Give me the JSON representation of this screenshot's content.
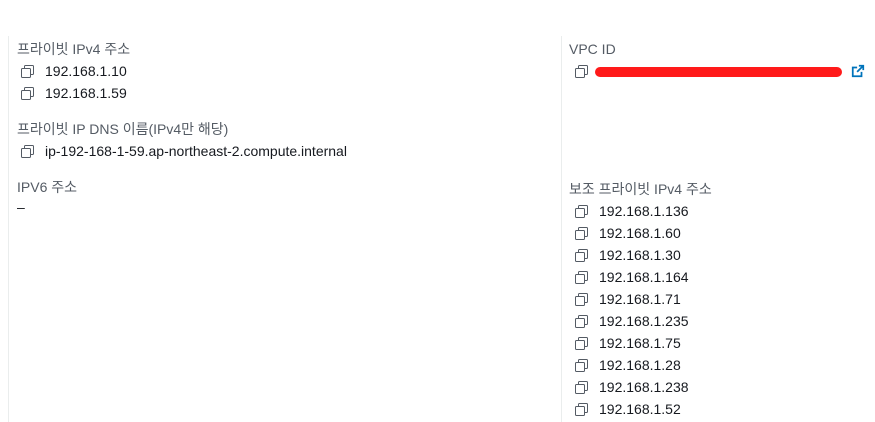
{
  "left": {
    "private_ipv4": {
      "label": "프라이빗 IPv4 주소",
      "values": [
        "192.168.1.10",
        "192.168.1.59"
      ]
    },
    "private_dns": {
      "label": "프라이빗 IP DNS 이름(IPv4만 해당)",
      "value": "ip-192-168-1-59.ap-northeast-2.compute.internal"
    },
    "ipv6": {
      "label": "IPV6 주소",
      "value": "–"
    }
  },
  "right": {
    "vpc": {
      "label": "VPC ID",
      "redacted": true,
      "redact_color": "#ff1a1a",
      "link_icon": "external-link-icon",
      "link_color": "#0073bb"
    },
    "secondary_ipv4": {
      "label": "보조 프라이빗 IPv4 주소",
      "values": [
        "192.168.1.136",
        "192.168.1.60",
        "192.168.1.30",
        "192.168.1.164",
        "192.168.1.71",
        "192.168.1.235",
        "192.168.1.75",
        "192.168.1.28",
        "192.168.1.238",
        "192.168.1.52"
      ]
    }
  },
  "icons": {
    "copy": "copy-icon"
  }
}
